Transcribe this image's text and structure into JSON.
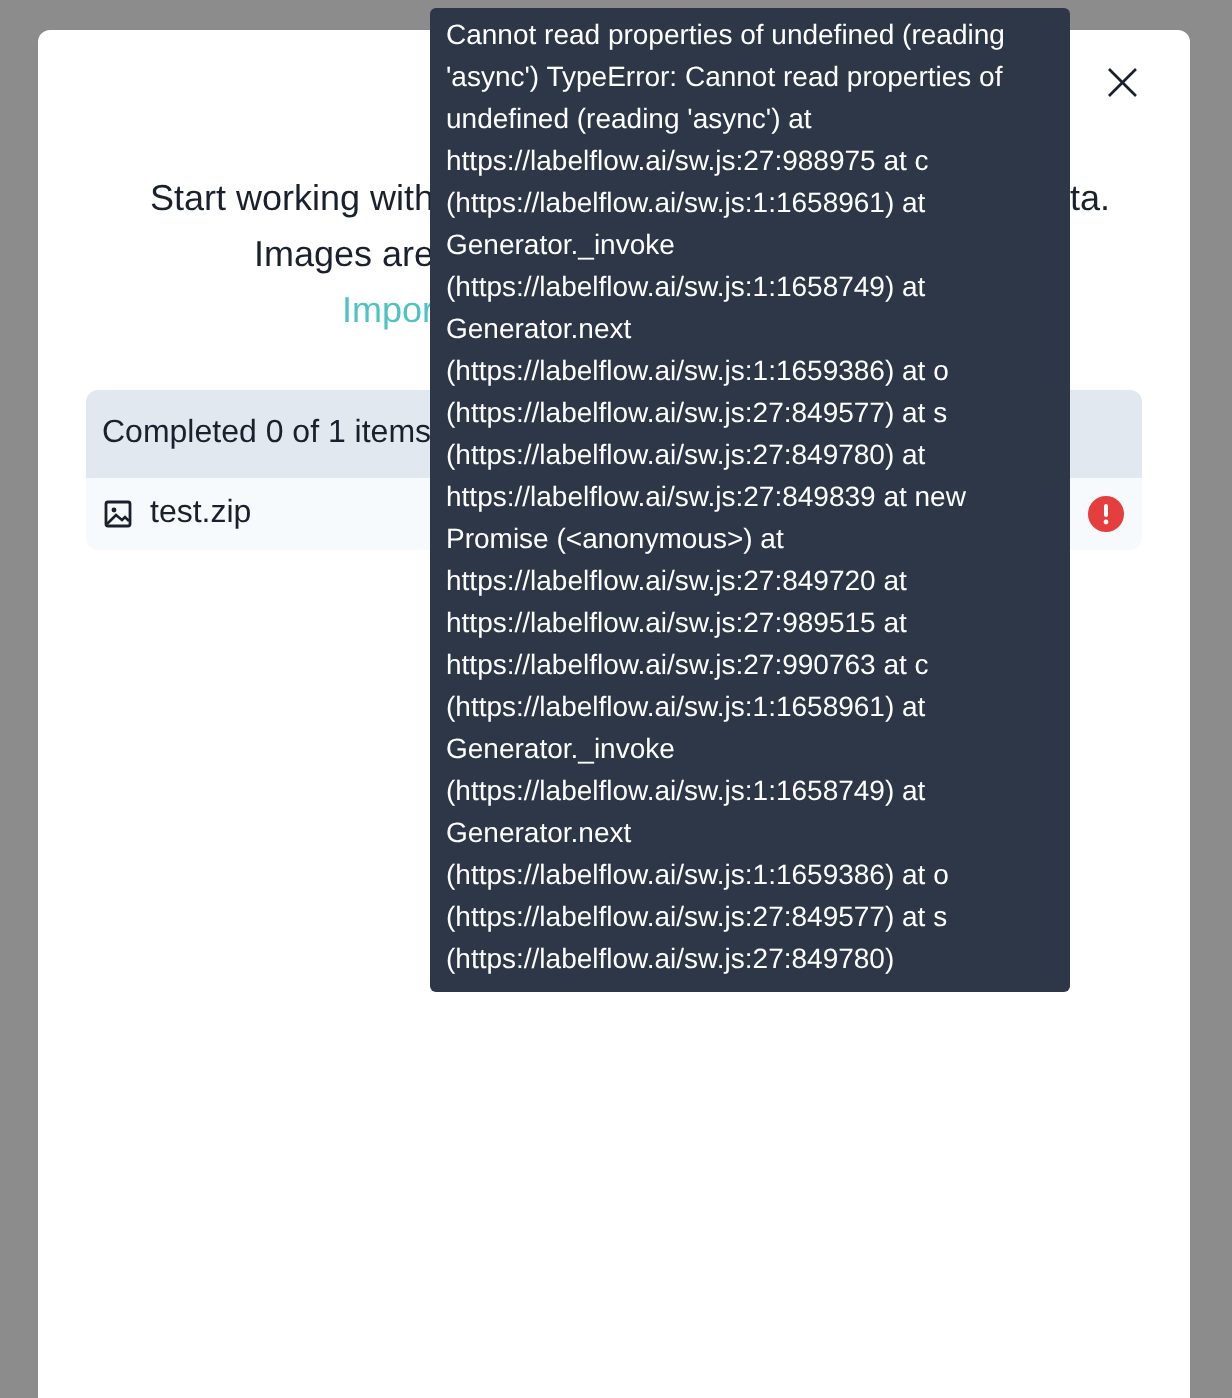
{
  "modal": {
    "close": "×",
    "intro_lines": [
      {
        "left": "Start working with",
        "right": "ta."
      },
      {
        "left": "Images are"
      }
    ],
    "link": "Impor",
    "table": {
      "header": "Completed 0 of 1 items",
      "rows": [
        {
          "name": "test.zip",
          "failed": true
        }
      ]
    }
  },
  "tooltip": {
    "text": "Cannot read properties of undefined (reading\n'async') TypeError: Cannot read properties of\nundefined (reading 'async') at\nhttps://labelflow.ai/sw.js:27:988975 at c\n(https://labelflow.ai/sw.js:1:1658961) at\nGenerator._invoke\n(https://labelflow.ai/sw.js:1:1658749) at\nGenerator.next\n(https://labelflow.ai/sw.js:1:1659386) at o\n(https://labelflow.ai/sw.js:27:849577) at s\n(https://labelflow.ai/sw.js:27:849780) at\nhttps://labelflow.ai/sw.js:27:849839 at new\nPromise (<anonymous>) at\nhttps://labelflow.ai/sw.js:27:849720 at\nhttps://labelflow.ai/sw.js:27:989515 at\nhttps://labelflow.ai/sw.js:27:990763 at c\n(https://labelflow.ai/sw.js:1:1658961) at\nGenerator._invoke\n(https://labelflow.ai/sw.js:1:1658749) at\nGenerator.next\n(https://labelflow.ai/sw.js:1:1659386) at o\n(https://labelflow.ai/sw.js:27:849577) at s\n(https://labelflow.ai/sw.js:27:849780)"
  }
}
